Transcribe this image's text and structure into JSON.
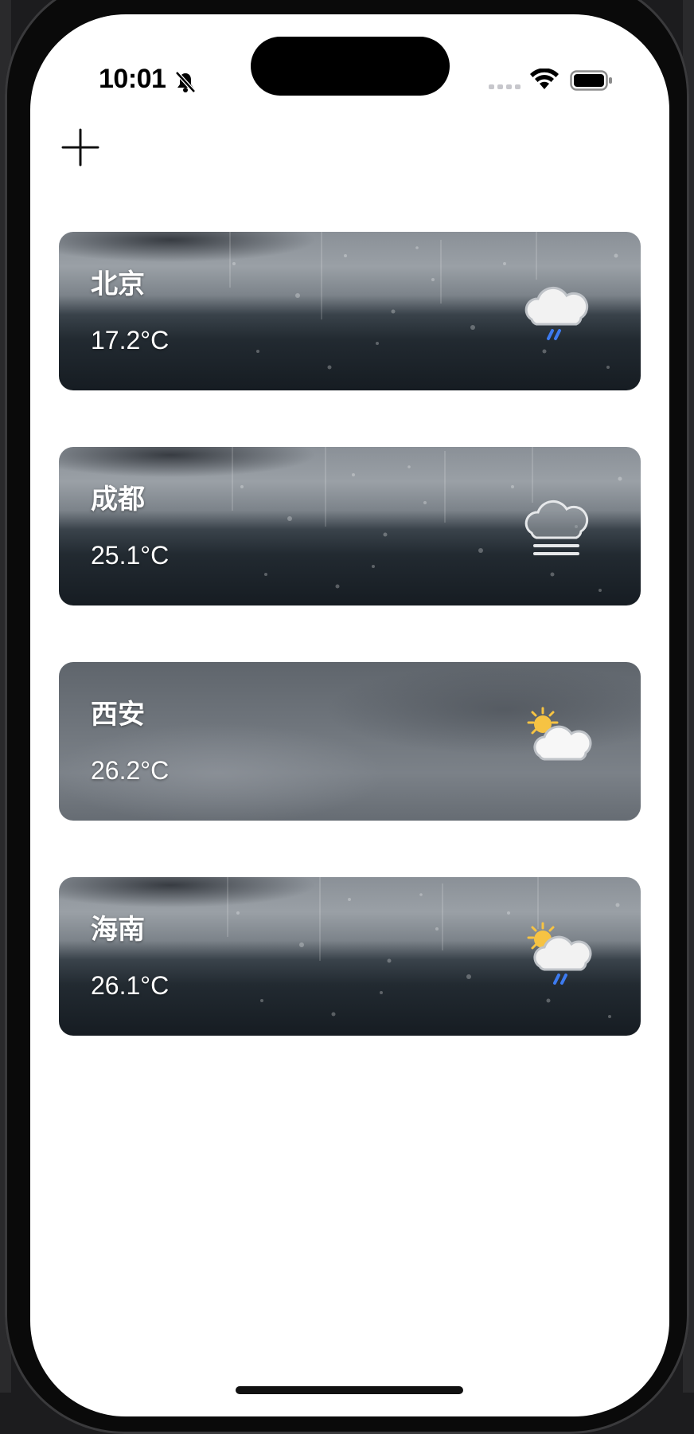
{
  "status_bar": {
    "time": "10:01",
    "silent_icon": "bell-slash-icon",
    "signal_icon": "cellular-signal-icon",
    "wifi_icon": "wifi-icon",
    "battery_icon": "battery-full-icon"
  },
  "toolbar": {
    "add_icon": "plus-icon"
  },
  "cities": [
    {
      "name": "北京",
      "temperature": "17.2°C",
      "weather_icon": "cloud-rain-icon",
      "background": "rainy-window"
    },
    {
      "name": "成都",
      "temperature": "25.1°C",
      "weather_icon": "cloud-fog-icon",
      "background": "rainy-window"
    },
    {
      "name": "西安",
      "temperature": "26.2°C",
      "weather_icon": "sun-behind-cloud-icon",
      "background": "overcast-sky"
    },
    {
      "name": "海南",
      "temperature": "26.1°C",
      "weather_icon": "sun-cloud-rain-icon",
      "background": "rainy-window"
    }
  ],
  "colors": {
    "screen_background": "#ffffff",
    "card_text": "#ffffff",
    "rain_streak": "#3d7bf0",
    "sun": "#f6c343"
  }
}
